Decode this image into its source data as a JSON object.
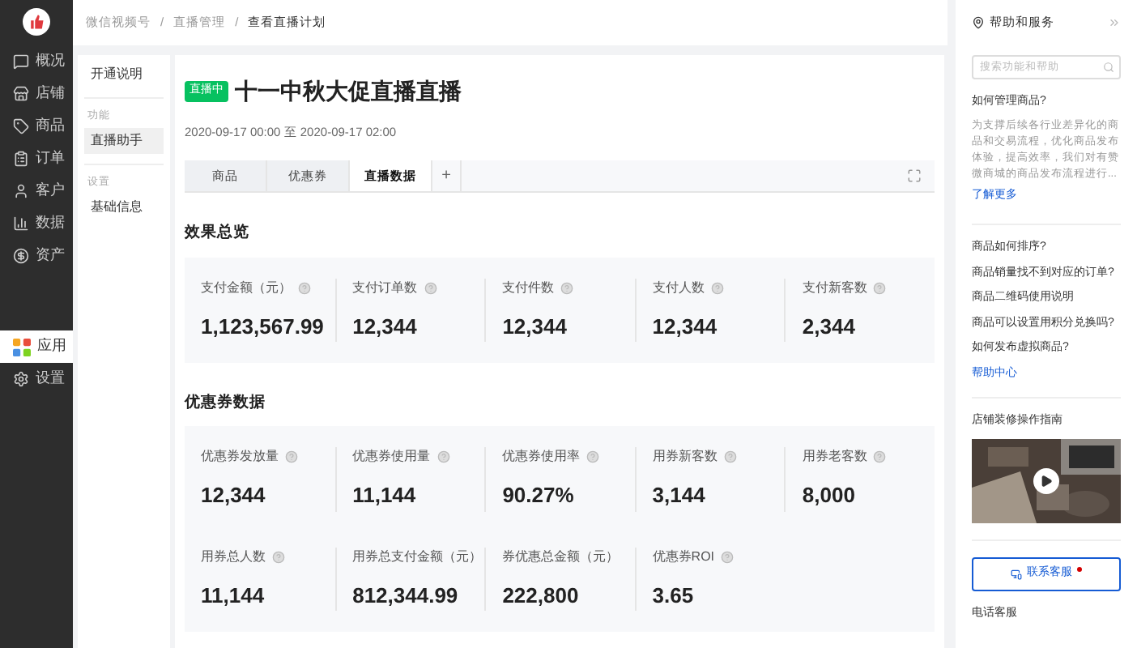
{
  "sidebar": {
    "items": [
      {
        "label": "概况",
        "selected": false
      },
      {
        "label": "店铺",
        "selected": false
      },
      {
        "label": "商品",
        "selected": false
      },
      {
        "label": "订单",
        "selected": false
      },
      {
        "label": "客户",
        "selected": false
      },
      {
        "label": "数据",
        "selected": false
      },
      {
        "label": "资产",
        "selected": false
      }
    ],
    "bottom_items": [
      {
        "label": "应用",
        "selected": true
      },
      {
        "label": "设置",
        "selected": false
      }
    ]
  },
  "breadcrumb": [
    {
      "label": "微信视频号"
    },
    {
      "separator": "/",
      "label": "直播管理"
    },
    {
      "separator": "/",
      "label": "查看直播计划"
    }
  ],
  "subnav": {
    "groups": [
      {
        "items": [
          {
            "label": "开通说明",
            "selected": false
          }
        ]
      },
      {
        "heading": "功能",
        "items": [
          {
            "label": "直播助手",
            "selected": true
          }
        ]
      },
      {
        "heading": "设置",
        "items": [
          {
            "label": "基础信息",
            "selected": false
          }
        ]
      }
    ]
  },
  "live": {
    "badge": "直播中",
    "title": "十一中秋大促直播直播",
    "time": "2020-09-17 00:00 至 2020-09-17 02:00"
  },
  "tabs": [
    {
      "label": "商品",
      "selected": false
    },
    {
      "label": "优惠券",
      "selected": false
    },
    {
      "label": "直播数据",
      "selected": true
    }
  ],
  "add_tab": "+",
  "sections": [
    {
      "title": "效果总览",
      "rows": [
        [
          {
            "label": "支付金额（元）",
            "value": "1,123,567.99"
          },
          {
            "label": "支付订单数",
            "value": "12,344"
          },
          {
            "label": "支付件数",
            "value": "12,344"
          },
          {
            "label": "支付人数",
            "value": "12,344"
          },
          {
            "label": "支付新客数",
            "value": "2,344"
          }
        ]
      ]
    },
    {
      "title": "优惠券数据",
      "rows": [
        [
          {
            "label": "优惠券发放量",
            "value": "12,344"
          },
          {
            "label": "优惠券使用量",
            "value": "11,144"
          },
          {
            "label": "优惠券使用率",
            "value": "90.27%"
          },
          {
            "label": "用券新客数",
            "value": "3,144"
          },
          {
            "label": "用券老客数",
            "value": "8,000"
          }
        ],
        [
          {
            "label": "用券总人数",
            "value": "11,144"
          },
          {
            "label": "用券总支付金额（元）",
            "value": "812,344.99"
          },
          {
            "label": "券优惠总金额（元）",
            "value": "222,800"
          },
          {
            "label": "优惠券ROI",
            "value": "3.65"
          }
        ]
      ]
    }
  ],
  "help": {
    "title": "帮助和服务",
    "search_placeholder": "搜索功能和帮助",
    "article_title": "如何管理商品?",
    "article_body": "为支撑后续各行业差异化的商品和交易流程，优化商品发布体验，提高效率，我们对有赞微商城的商品发布流程进行...",
    "more_link": "了解更多",
    "questions": [
      "商品如何排序?",
      "商品销量找不到对应的订单?",
      "商品二维码使用说明",
      "商品可以设置用积分兑换吗?",
      "如何发布虚拟商品?"
    ],
    "center_link": "帮助中心",
    "video_title": "店铺装修操作指南",
    "contact_button": "联系客服",
    "phone_title": "电话客服"
  }
}
